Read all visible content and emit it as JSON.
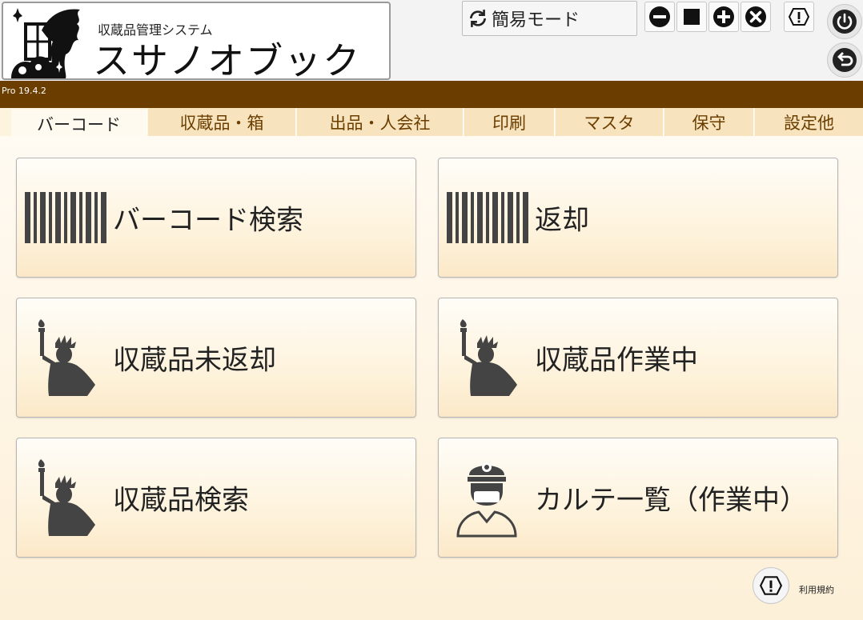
{
  "header": {
    "subtitle": "収蔵品管理システム",
    "app_title": "スサノオブック",
    "mode_label": "簡易モード",
    "version": "Pro 19.4.2"
  },
  "tabs": [
    {
      "label": "バーコード",
      "active": true
    },
    {
      "label": "収蔵品・箱",
      "active": false
    },
    {
      "label": "出品・人会社",
      "active": false
    },
    {
      "label": "印刷",
      "active": false
    },
    {
      "label": "マスタ",
      "active": false
    },
    {
      "label": "保守",
      "active": false
    },
    {
      "label": "設定他",
      "active": false
    }
  ],
  "menu": [
    {
      "label": "バーコード検索",
      "icon": "barcode-icon"
    },
    {
      "label": "返却",
      "icon": "barcode-icon"
    },
    {
      "label": "収蔵品未返却",
      "icon": "statue-of-liberty-icon"
    },
    {
      "label": "収蔵品作業中",
      "icon": "statue-of-liberty-icon"
    },
    {
      "label": "収蔵品検索",
      "icon": "statue-of-liberty-icon"
    },
    {
      "label": "カルテ一覧（作業中）",
      "icon": "doctor-icon"
    }
  ],
  "footer": {
    "terms_label": "利用規約"
  },
  "colors": {
    "brand_brown": "#6b3e00",
    "tab_bg": "#f7e3bd",
    "tab_text": "#6b3e00"
  }
}
